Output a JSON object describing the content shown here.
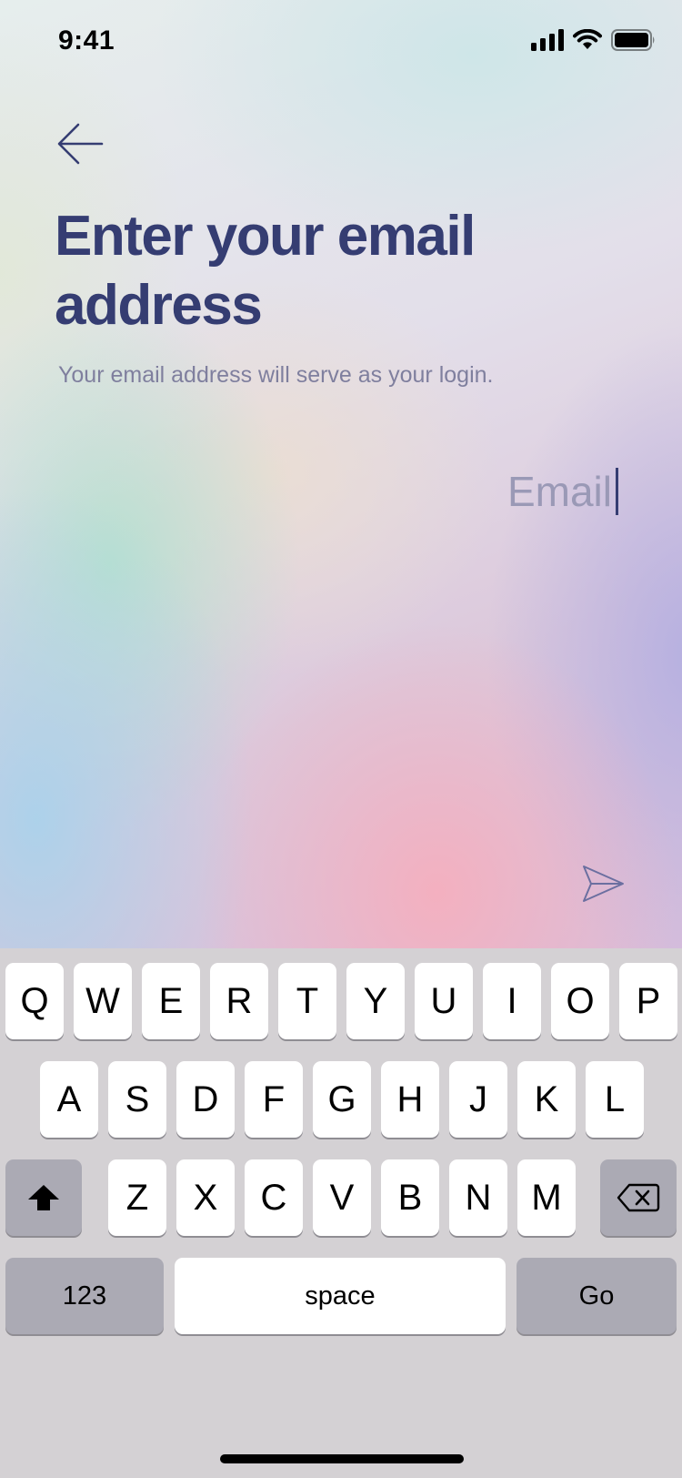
{
  "status_bar": {
    "time": "9:41"
  },
  "header": {
    "title": "Enter your email address",
    "subtitle": "Your email address will serve as your login."
  },
  "form": {
    "email_placeholder": "Email",
    "email_value": ""
  },
  "icons": {
    "back": "arrow-left-icon",
    "send": "send-icon",
    "shift": "shift-icon",
    "delete": "backspace-icon",
    "signal": "cellular-signal-icon",
    "wifi": "wifi-icon",
    "battery": "battery-icon"
  },
  "keyboard": {
    "row1": [
      "Q",
      "W",
      "E",
      "R",
      "T",
      "Y",
      "U",
      "I",
      "O",
      "P"
    ],
    "row2": [
      "A",
      "S",
      "D",
      "F",
      "G",
      "H",
      "J",
      "K",
      "L"
    ],
    "row3": [
      "Z",
      "X",
      "C",
      "V",
      "B",
      "N",
      "M"
    ],
    "numbers_label": "123",
    "space_label": "space",
    "go_label": "Go"
  },
  "colors": {
    "title": "#353d72",
    "subtitle": "#7f7f9e",
    "placeholder": "#9a99b6",
    "keyboard_bg": "#d4d1d4",
    "key_light": "#ffffff",
    "key_dark": "#abaab4"
  }
}
